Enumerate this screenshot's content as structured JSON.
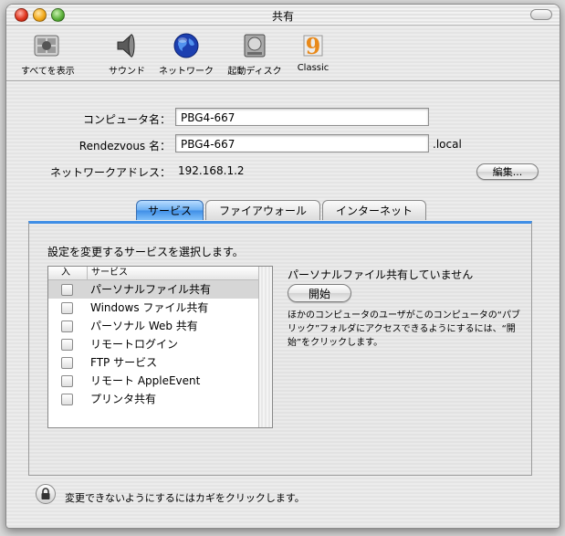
{
  "window": {
    "title": "共有"
  },
  "toolbar": {
    "items": [
      {
        "label": "すべてを表示",
        "icon": "show-all-icon"
      },
      {
        "label": "サウンド",
        "icon": "speaker-icon"
      },
      {
        "label": "ネットワーク",
        "icon": "globe-icon"
      },
      {
        "label": "起動ディスク",
        "icon": "hard-disk-icon"
      },
      {
        "label": "Classic",
        "icon": "classic-9-icon"
      }
    ]
  },
  "form": {
    "computer_name_label": "コンピュータ名：",
    "computer_name_value": "PBG4-667",
    "rendezvous_label": "Rendezvous 名：",
    "rendezvous_value": "PBG4-667",
    "rendezvous_suffix": ".local",
    "address_label": "ネットワークアドレス：",
    "address_value": "192.168.1.2",
    "edit_button": "編集..."
  },
  "tabs": [
    {
      "label": "サービス",
      "selected": true
    },
    {
      "label": "ファイアウォール",
      "selected": false
    },
    {
      "label": "インターネット",
      "selected": false
    }
  ],
  "services_panel": {
    "title": "設定を変更するサービスを選択します。",
    "col_on": "入",
    "col_service": "サービス",
    "items": [
      {
        "label": "パーソナルファイル共有",
        "checked": false,
        "selected": true
      },
      {
        "label": "Windows ファイル共有",
        "checked": false,
        "selected": false
      },
      {
        "label": "パーソナル Web 共有",
        "checked": false,
        "selected": false
      },
      {
        "label": "リモートログイン",
        "checked": false,
        "selected": false
      },
      {
        "label": "FTP サービス",
        "checked": false,
        "selected": false
      },
      {
        "label": "リモート AppleEvent",
        "checked": false,
        "selected": false
      },
      {
        "label": "プリンタ共有",
        "checked": false,
        "selected": false
      }
    ],
    "status_text": "パーソナルファイル共有していません",
    "start_button": "開始",
    "description": "ほかのコンピュータのユーザがこのコンピュータの“パブリック”フォルダにアクセスできるようにするには、“開始”をクリックします。"
  },
  "lock": {
    "text": "変更できないようにするにはカギをクリックします。"
  },
  "colors": {
    "accent": "#3f8ee6"
  }
}
